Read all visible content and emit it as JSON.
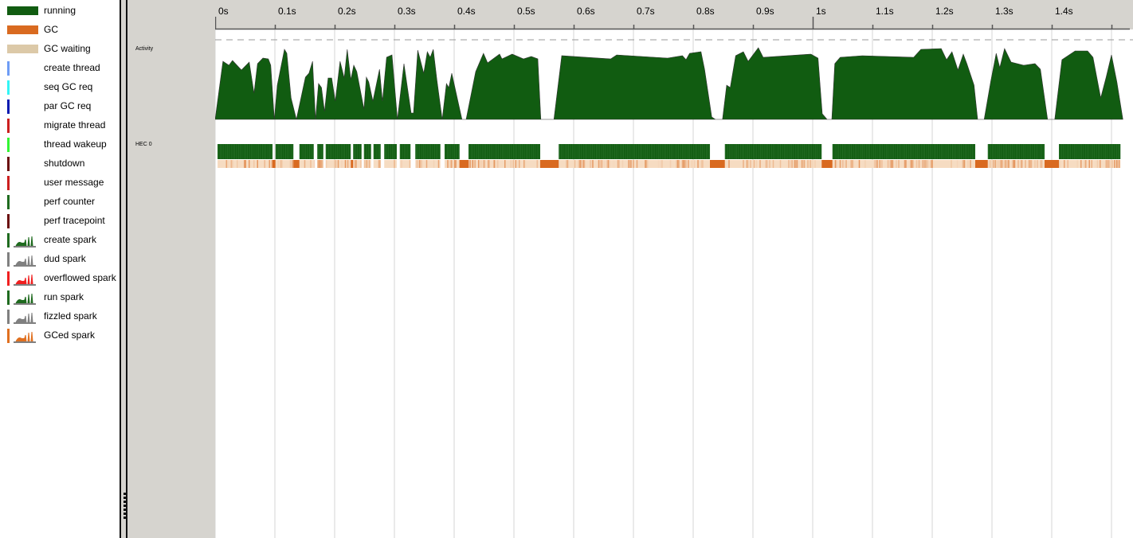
{
  "legend": [
    {
      "label": "running",
      "kind": "swatch",
      "color": "#115c11"
    },
    {
      "label": "GC",
      "kind": "swatch",
      "color": "#d96a20"
    },
    {
      "label": "GC waiting",
      "kind": "swatch",
      "color": "#dcc9a8"
    },
    {
      "label": "create thread",
      "kind": "bar",
      "color": "#6e9cf5"
    },
    {
      "label": "seq GC req",
      "kind": "bar",
      "color": "#33f5f5"
    },
    {
      "label": "par GC req",
      "kind": "bar",
      "color": "#0a1ab0"
    },
    {
      "label": "migrate thread",
      "kind": "bar",
      "color": "#cc1f1f"
    },
    {
      "label": "thread wakeup",
      "kind": "bar",
      "color": "#33f533"
    },
    {
      "label": "shutdown",
      "kind": "bar",
      "color": "#6b0f0f"
    },
    {
      "label": "user message",
      "kind": "bar",
      "color": "#cc1f1f"
    },
    {
      "label": "perf counter",
      "kind": "bar",
      "color": "#1f6b1f"
    },
    {
      "label": "perf tracepoint",
      "kind": "bar",
      "color": "#6b0f0f"
    },
    {
      "label": "create spark",
      "kind": "spark",
      "color": "#1f6b1f"
    },
    {
      "label": "dud spark",
      "kind": "spark",
      "color": "#808080"
    },
    {
      "label": "overflowed spark",
      "kind": "spark",
      "color": "#f02020"
    },
    {
      "label": "run spark",
      "kind": "spark",
      "color": "#1f6b1f"
    },
    {
      "label": "fizzled spark",
      "kind": "spark",
      "color": "#808080"
    },
    {
      "label": "GCed spark",
      "kind": "spark",
      "color": "#e07020"
    }
  ],
  "rows": {
    "activity": "Activity",
    "hec0": "HEC 0"
  },
  "axis": {
    "ticks": [
      0,
      0.1,
      0.2,
      0.3,
      0.4,
      0.5,
      0.6,
      0.7,
      0.8,
      0.9,
      1.0,
      1.1,
      1.2,
      1.3,
      1.4,
      1.5
    ],
    "labels": [
      "0s",
      "0.1s",
      "0.2s",
      "0.3s",
      "0.4s",
      "0.5s",
      "0.6s",
      "0.7s",
      "0.8s",
      "0.9s",
      "1s",
      "1.1s",
      "1.2s",
      "1.3s",
      "1.4s",
      ""
    ]
  },
  "colors": {
    "running": "#115c11",
    "gc": "#d96a20",
    "gc_light": "#f6dcc2",
    "grid": "#e4e4e4"
  },
  "activity": [
    [
      0,
      0
    ],
    [
      0.013,
      0.73
    ],
    [
      0.023,
      0.68
    ],
    [
      0.029,
      0.74
    ],
    [
      0.044,
      0.62
    ],
    [
      0.057,
      0.72
    ],
    [
      0.065,
      0.33
    ],
    [
      0.071,
      0.7
    ],
    [
      0.08,
      0.77
    ],
    [
      0.089,
      0.76
    ],
    [
      0.093,
      0.68
    ],
    [
      0.099,
      0
    ],
    [
      0.104,
      0.43
    ],
    [
      0.116,
      0.88
    ],
    [
      0.12,
      0.83
    ],
    [
      0.127,
      0.27
    ],
    [
      0.136,
      0
    ],
    [
      0.151,
      0.53
    ],
    [
      0.157,
      0.58
    ],
    [
      0.163,
      0.73
    ],
    [
      0.168,
      0
    ],
    [
      0.173,
      0.45
    ],
    [
      0.178,
      0.4
    ],
    [
      0.183,
      0.1
    ],
    [
      0.189,
      0.52
    ],
    [
      0.195,
      0.52
    ],
    [
      0.201,
      0.23
    ],
    [
      0.209,
      0.73
    ],
    [
      0.216,
      0.52
    ],
    [
      0.221,
      0.88
    ],
    [
      0.227,
      0.5
    ],
    [
      0.232,
      0.68
    ],
    [
      0.237,
      0.6
    ],
    [
      0.249,
      0.13
    ],
    [
      0.253,
      0.53
    ],
    [
      0.257,
      0.47
    ],
    [
      0.264,
      0.23
    ],
    [
      0.275,
      0.63
    ],
    [
      0.28,
      0.23
    ],
    [
      0.287,
      0.78
    ],
    [
      0.296,
      0.81
    ],
    [
      0.305,
      0
    ],
    [
      0.316,
      0.7
    ],
    [
      0.328,
      0.08
    ],
    [
      0.332,
      0.08
    ],
    [
      0.339,
      0.87
    ],
    [
      0.349,
      0.58
    ],
    [
      0.355,
      0.85
    ],
    [
      0.36,
      0.78
    ],
    [
      0.365,
      0.88
    ],
    [
      0.371,
      0.5
    ],
    [
      0.38,
      0
    ],
    [
      0.387,
      0.45
    ],
    [
      0.391,
      0.4
    ],
    [
      0.396,
      0.58
    ],
    [
      0.413,
      0
    ],
    [
      0.42,
      0
    ],
    [
      0.436,
      0.6
    ],
    [
      0.449,
      0.83
    ],
    [
      0.456,
      0.71
    ],
    [
      0.476,
      0.82
    ],
    [
      0.48,
      0.76
    ],
    [
      0.497,
      0.82
    ],
    [
      0.516,
      0.76
    ],
    [
      0.529,
      0.79
    ],
    [
      0.54,
      0.76
    ],
    [
      0.545,
      0
    ],
    [
      0.567,
      0
    ],
    [
      0.58,
      0.8
    ],
    [
      0.662,
      0.76
    ],
    [
      0.672,
      0.81
    ],
    [
      0.757,
      0.77
    ],
    [
      0.782,
      0.8
    ],
    [
      0.788,
      0.75
    ],
    [
      0.794,
      0.83
    ],
    [
      0.813,
      0.85
    ],
    [
      0.819,
      0.63
    ],
    [
      0.831,
      0.03
    ],
    [
      0.837,
      0
    ],
    [
      0.849,
      0
    ],
    [
      0.856,
      0.43
    ],
    [
      0.862,
      0.4
    ],
    [
      0.871,
      0.8
    ],
    [
      0.884,
      0.85
    ],
    [
      0.892,
      0.73
    ],
    [
      0.909,
      0.9
    ],
    [
      0.917,
      0.78
    ],
    [
      0.997,
      0.82
    ],
    [
      1.009,
      0.77
    ],
    [
      1.016,
      0.07
    ],
    [
      1.024,
      0
    ],
    [
      1.032,
      0
    ],
    [
      1.037,
      0.7
    ],
    [
      1.046,
      0.78
    ],
    [
      1.083,
      0.8
    ],
    [
      1.169,
      0.78
    ],
    [
      1.181,
      0.88
    ],
    [
      1.215,
      0.89
    ],
    [
      1.224,
      0.75
    ],
    [
      1.233,
      0.85
    ],
    [
      1.243,
      0.62
    ],
    [
      1.252,
      0.82
    ],
    [
      1.258,
      0.7
    ],
    [
      1.27,
      0.43
    ],
    [
      1.276,
      0
    ],
    [
      1.287,
      0
    ],
    [
      1.298,
      0.48
    ],
    [
      1.307,
      0.83
    ],
    [
      1.313,
      0.65
    ],
    [
      1.321,
      0.89
    ],
    [
      1.332,
      0.72
    ],
    [
      1.353,
      0.68
    ],
    [
      1.372,
      0.7
    ],
    [
      1.381,
      0.63
    ],
    [
      1.393,
      0
    ],
    [
      1.405,
      0
    ],
    [
      1.417,
      0.75
    ],
    [
      1.439,
      0.86
    ],
    [
      1.46,
      0.86
    ],
    [
      1.469,
      0.78
    ],
    [
      1.482,
      0.27
    ],
    [
      1.491,
      0.53
    ],
    [
      1.5,
      0.81
    ],
    [
      1.509,
      0.47
    ],
    [
      1.519,
      0
    ]
  ],
  "hec0": {
    "running": [
      [
        0.004,
        0.096
      ],
      [
        0.101,
        0.131
      ],
      [
        0.141,
        0.165
      ],
      [
        0.171,
        0.181
      ],
      [
        0.185,
        0.227
      ],
      [
        0.231,
        0.245
      ],
      [
        0.249,
        0.261
      ],
      [
        0.265,
        0.277
      ],
      [
        0.283,
        0.304
      ],
      [
        0.309,
        0.327
      ],
      [
        0.335,
        0.377
      ],
      [
        0.384,
        0.409
      ],
      [
        0.424,
        0.544
      ],
      [
        0.575,
        0.828
      ],
      [
        0.853,
        1.015
      ],
      [
        1.033,
        1.272
      ],
      [
        1.293,
        1.388
      ],
      [
        1.412,
        1.515
      ]
    ],
    "gc": [
      [
        0.096,
        0.101
      ],
      [
        0.131,
        0.141
      ],
      [
        0.227,
        0.231
      ],
      [
        0.409,
        0.424
      ],
      [
        0.544,
        0.575
      ],
      [
        0.828,
        0.853
      ],
      [
        1.015,
        1.033
      ],
      [
        1.272,
        1.293
      ],
      [
        1.388,
        1.412
      ]
    ]
  }
}
